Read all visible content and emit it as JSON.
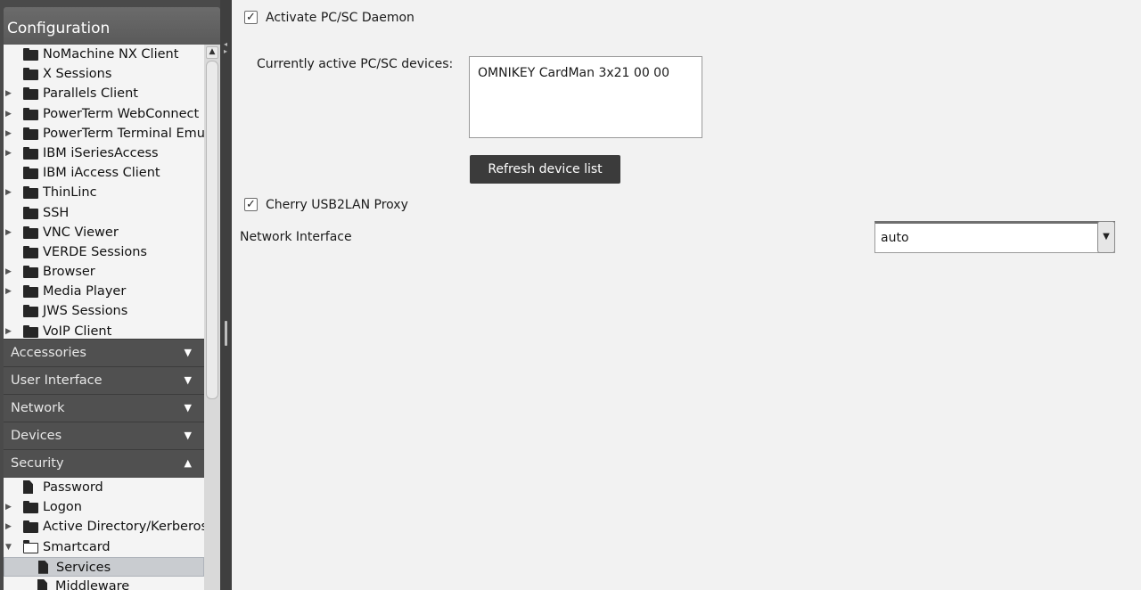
{
  "sidebar": {
    "title": "Configuration",
    "tree_top": [
      {
        "label": "NoMachine NX Client",
        "arrow": "",
        "icon": "folder"
      },
      {
        "label": "X Sessions",
        "arrow": "",
        "icon": "folder"
      },
      {
        "label": "Parallels Client",
        "arrow": "▶",
        "icon": "folder"
      },
      {
        "label": "PowerTerm WebConnect",
        "arrow": "▶",
        "icon": "folder"
      },
      {
        "label": "PowerTerm Terminal Emulation",
        "arrow": "▶",
        "icon": "folder"
      },
      {
        "label": "IBM iSeriesAccess",
        "arrow": "▶",
        "icon": "folder"
      },
      {
        "label": "IBM iAccess Client",
        "arrow": "",
        "icon": "folder"
      },
      {
        "label": "ThinLinc",
        "arrow": "▶",
        "icon": "folder"
      },
      {
        "label": "SSH",
        "arrow": "",
        "icon": "folder"
      },
      {
        "label": "VNC Viewer",
        "arrow": "▶",
        "icon": "folder"
      },
      {
        "label": "VERDE Sessions",
        "arrow": "",
        "icon": "folder"
      },
      {
        "label": "Browser",
        "arrow": "▶",
        "icon": "folder"
      },
      {
        "label": "Media Player",
        "arrow": "▶",
        "icon": "folder"
      },
      {
        "label": "JWS Sessions",
        "arrow": "",
        "icon": "folder"
      },
      {
        "label": "VoIP Client",
        "arrow": "▶",
        "icon": "folder"
      }
    ],
    "categories": [
      {
        "label": "Accessories",
        "caret": "▼"
      },
      {
        "label": "User Interface",
        "caret": "▼"
      },
      {
        "label": "Network",
        "caret": "▼"
      },
      {
        "label": "Devices",
        "caret": "▼"
      },
      {
        "label": "Security",
        "caret": "▲"
      }
    ],
    "tree_bottom": [
      {
        "label": "Password",
        "arrow": "",
        "icon": "doc"
      },
      {
        "label": "Logon",
        "arrow": "▶",
        "icon": "folder"
      },
      {
        "label": "Active Directory/Kerberos",
        "arrow": "▶",
        "icon": "folder"
      },
      {
        "label": "Smartcard",
        "arrow": "▼",
        "icon": "folder-open"
      },
      {
        "label": "Services",
        "arrow": "",
        "icon": "doc",
        "sub": true,
        "selected": true
      },
      {
        "label": "Middleware",
        "arrow": "",
        "icon": "doc",
        "sub": true
      }
    ]
  },
  "main": {
    "activate_pcsc": {
      "label": "Activate PC/SC Daemon",
      "checked": "✓"
    },
    "active_devices_label": "Currently active PC/SC devices:",
    "active_devices": [
      "OMNIKEY CardMan 3x21 00 00"
    ],
    "refresh_button": "Refresh device list",
    "cherry_proxy": {
      "label": "Cherry USB2LAN Proxy",
      "checked": "✓"
    },
    "network_interface_label": "Network Interface",
    "network_interface_value": "auto"
  }
}
